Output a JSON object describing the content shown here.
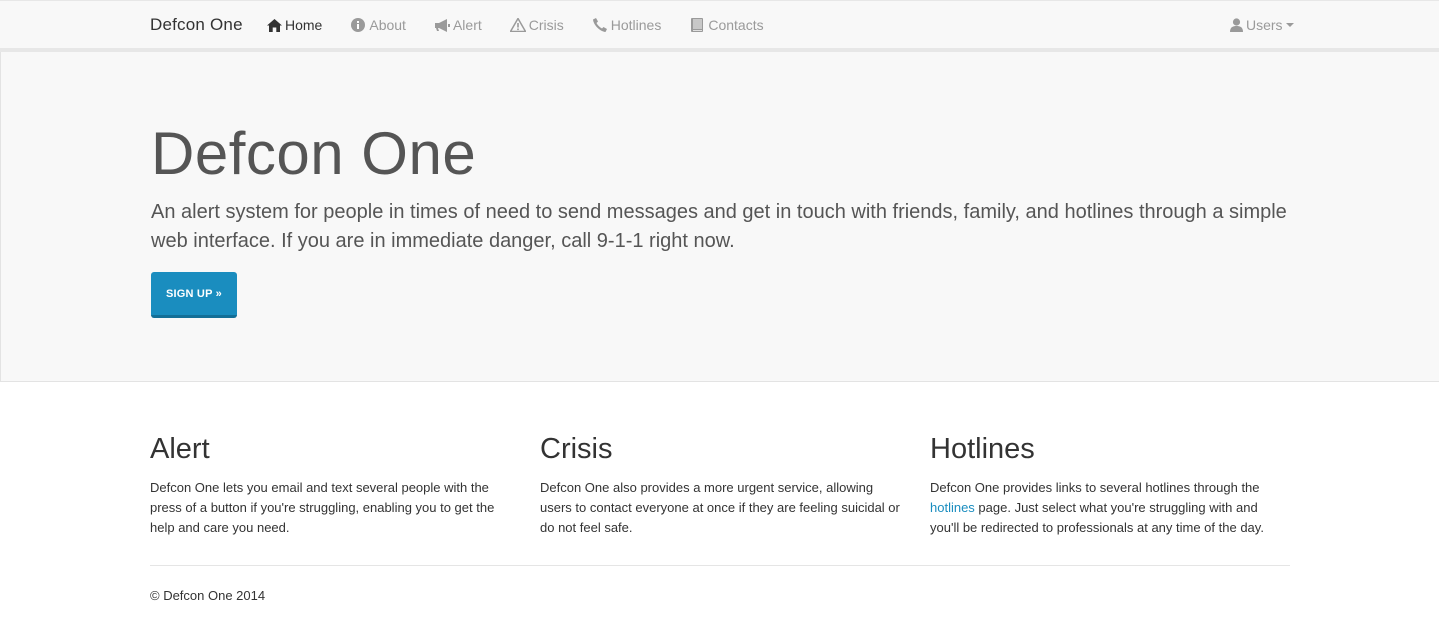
{
  "navbar": {
    "brand": "Defcon One",
    "items": [
      {
        "label": "Home",
        "icon": "home-icon",
        "active": true
      },
      {
        "label": "About",
        "icon": "info-circle-icon",
        "active": false
      },
      {
        "label": "Alert",
        "icon": "bullhorn-icon",
        "active": false
      },
      {
        "label": "Crisis",
        "icon": "warning-icon",
        "active": false
      },
      {
        "label": "Hotlines",
        "icon": "phone-icon",
        "active": false
      },
      {
        "label": "Contacts",
        "icon": "book-icon",
        "active": false
      }
    ],
    "user_menu": {
      "label": "Users",
      "icon": "user-icon"
    }
  },
  "jumbotron": {
    "title": "Defcon One",
    "lead": "An alert system for people in times of need to send messages and get in touch with friends, family, and hotlines through a simple web interface. If you are in immediate danger, call 9-1-1 right now.",
    "button_label": "SIGN UP »"
  },
  "features": {
    "alert": {
      "heading": "Alert",
      "body": "Defcon One lets you email and text several people with the press of a button if you're struggling, enabling you to get the help and care you need."
    },
    "crisis": {
      "heading": "Crisis",
      "body": "Defcon One also provides a more urgent service, allowing users to contact everyone at once if they are feeling suicidal or do not feel safe."
    },
    "hotlines": {
      "heading": "Hotlines",
      "body_before": "Defcon One provides links to several hotlines through the ",
      "link_text": "hotlines",
      "body_after": " page. Just select what you're struggling with and you'll be redirected to professionals at any time of the day."
    }
  },
  "footer": {
    "text": "© Defcon One 2014"
  },
  "colors": {
    "navbar_bg": "#f8f8f8",
    "jumbotron_bg": "#f8f8f8",
    "accent": "#1a8dbf",
    "nav_text": "#9a9a9a",
    "nav_active": "#333333"
  }
}
